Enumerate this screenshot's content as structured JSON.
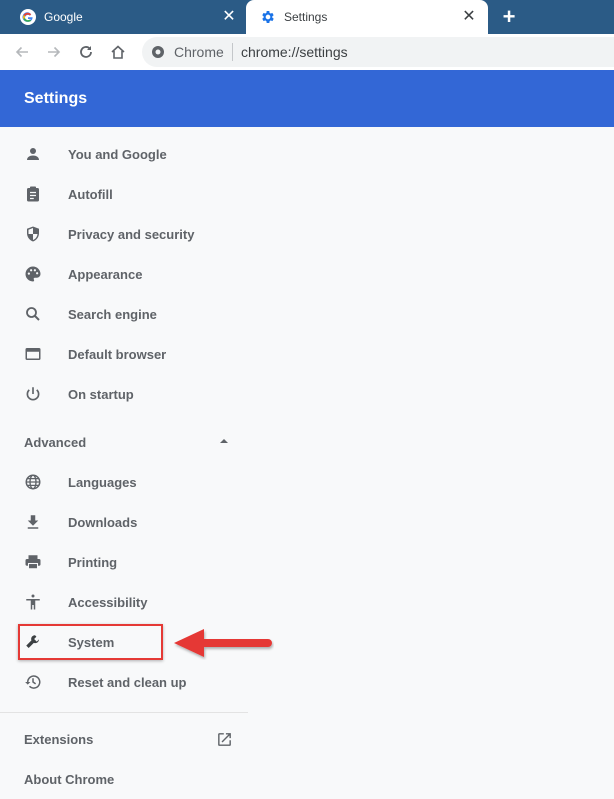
{
  "browser": {
    "tabs": [
      {
        "title": "Google",
        "icon": "google-g-icon",
        "active": false
      },
      {
        "title": "Settings",
        "icon": "gear-icon",
        "active": true
      }
    ],
    "close_glyph": "✕",
    "new_tab_glyph": "+",
    "omnibox": {
      "chip": "Chrome",
      "url": "chrome://settings"
    }
  },
  "header": {
    "title": "Settings"
  },
  "sidebar": {
    "items": [
      {
        "label": "You and Google",
        "icon": "person-icon"
      },
      {
        "label": "Autofill",
        "icon": "clipboard-icon"
      },
      {
        "label": "Privacy and security",
        "icon": "shield-icon"
      },
      {
        "label": "Appearance",
        "icon": "palette-icon"
      },
      {
        "label": "Search engine",
        "icon": "search-icon"
      },
      {
        "label": "Default browser",
        "icon": "browser-window-icon"
      },
      {
        "label": "On startup",
        "icon": "power-icon"
      }
    ],
    "advanced": {
      "label": "Advanced",
      "expanded": true
    },
    "advanced_items": [
      {
        "label": "Languages",
        "icon": "globe-icon"
      },
      {
        "label": "Downloads",
        "icon": "download-icon"
      },
      {
        "label": "Printing",
        "icon": "printer-icon"
      },
      {
        "label": "Accessibility",
        "icon": "accessibility-icon"
      },
      {
        "label": "System",
        "icon": "wrench-icon",
        "highlighted": true
      },
      {
        "label": "Reset and clean up",
        "icon": "history-icon"
      }
    ],
    "extensions": {
      "label": "Extensions",
      "icon": "open-in-new-icon"
    },
    "about": {
      "label": "About Chrome"
    }
  },
  "annotation": {
    "target": "System",
    "color": "#e53935"
  },
  "colors": {
    "header_bg": "#3367d6",
    "tabstrip_bg": "#2b5b86",
    "text": "#5f6368",
    "page_bg": "#f8f9fa"
  }
}
